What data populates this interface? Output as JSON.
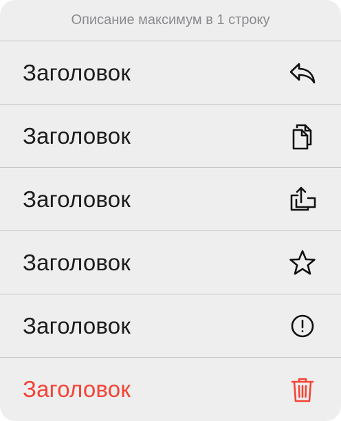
{
  "menu": {
    "description": "Описание максимум в 1 строку",
    "items": [
      {
        "label": "Заголовок",
        "icon": "reply-icon",
        "destructive": false
      },
      {
        "label": "Заголовок",
        "icon": "copy-icon",
        "destructive": false
      },
      {
        "label": "Заголовок",
        "icon": "share-icon",
        "destructive": false
      },
      {
        "label": "Заголовок",
        "icon": "star-icon",
        "destructive": false
      },
      {
        "label": "Заголовок",
        "icon": "exclamation-circle-icon",
        "destructive": false
      },
      {
        "label": "Заголовок",
        "icon": "trash-icon",
        "destructive": true
      }
    ]
  },
  "colors": {
    "background": "#eeeeee",
    "separator": "#c6c6c8",
    "text": "#1c1c1e",
    "description": "#8a8a8e",
    "destructive": "#f44336"
  }
}
